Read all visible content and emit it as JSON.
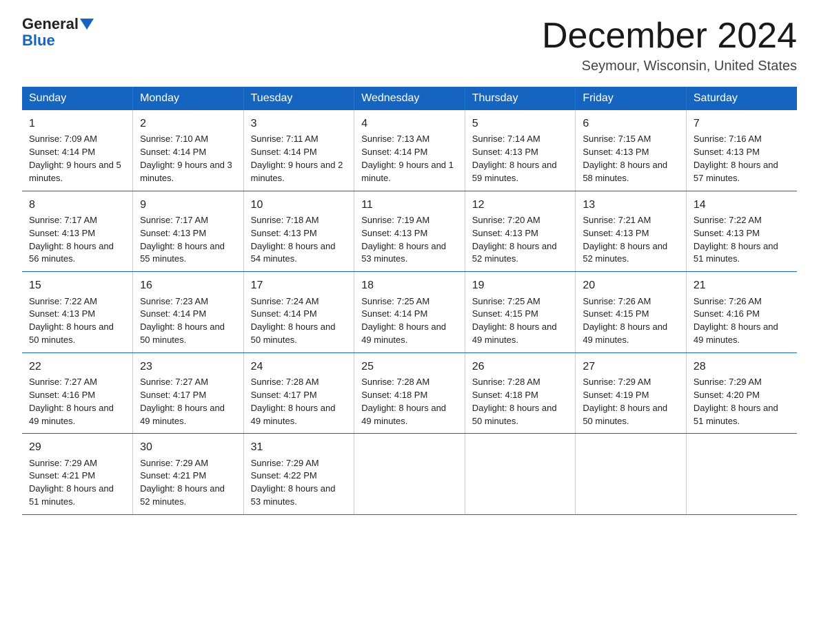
{
  "logo": {
    "general": "General",
    "blue": "Blue"
  },
  "title": {
    "month_year": "December 2024",
    "location": "Seymour, Wisconsin, United States"
  },
  "days_of_week": [
    "Sunday",
    "Monday",
    "Tuesday",
    "Wednesday",
    "Thursday",
    "Friday",
    "Saturday"
  ],
  "weeks": [
    [
      {
        "day": "1",
        "sunrise": "Sunrise: 7:09 AM",
        "sunset": "Sunset: 4:14 PM",
        "daylight": "Daylight: 9 hours and 5 minutes."
      },
      {
        "day": "2",
        "sunrise": "Sunrise: 7:10 AM",
        "sunset": "Sunset: 4:14 PM",
        "daylight": "Daylight: 9 hours and 3 minutes."
      },
      {
        "day": "3",
        "sunrise": "Sunrise: 7:11 AM",
        "sunset": "Sunset: 4:14 PM",
        "daylight": "Daylight: 9 hours and 2 minutes."
      },
      {
        "day": "4",
        "sunrise": "Sunrise: 7:13 AM",
        "sunset": "Sunset: 4:14 PM",
        "daylight": "Daylight: 9 hours and 1 minute."
      },
      {
        "day": "5",
        "sunrise": "Sunrise: 7:14 AM",
        "sunset": "Sunset: 4:13 PM",
        "daylight": "Daylight: 8 hours and 59 minutes."
      },
      {
        "day": "6",
        "sunrise": "Sunrise: 7:15 AM",
        "sunset": "Sunset: 4:13 PM",
        "daylight": "Daylight: 8 hours and 58 minutes."
      },
      {
        "day": "7",
        "sunrise": "Sunrise: 7:16 AM",
        "sunset": "Sunset: 4:13 PM",
        "daylight": "Daylight: 8 hours and 57 minutes."
      }
    ],
    [
      {
        "day": "8",
        "sunrise": "Sunrise: 7:17 AM",
        "sunset": "Sunset: 4:13 PM",
        "daylight": "Daylight: 8 hours and 56 minutes."
      },
      {
        "day": "9",
        "sunrise": "Sunrise: 7:17 AM",
        "sunset": "Sunset: 4:13 PM",
        "daylight": "Daylight: 8 hours and 55 minutes."
      },
      {
        "day": "10",
        "sunrise": "Sunrise: 7:18 AM",
        "sunset": "Sunset: 4:13 PM",
        "daylight": "Daylight: 8 hours and 54 minutes."
      },
      {
        "day": "11",
        "sunrise": "Sunrise: 7:19 AM",
        "sunset": "Sunset: 4:13 PM",
        "daylight": "Daylight: 8 hours and 53 minutes."
      },
      {
        "day": "12",
        "sunrise": "Sunrise: 7:20 AM",
        "sunset": "Sunset: 4:13 PM",
        "daylight": "Daylight: 8 hours and 52 minutes."
      },
      {
        "day": "13",
        "sunrise": "Sunrise: 7:21 AM",
        "sunset": "Sunset: 4:13 PM",
        "daylight": "Daylight: 8 hours and 52 minutes."
      },
      {
        "day": "14",
        "sunrise": "Sunrise: 7:22 AM",
        "sunset": "Sunset: 4:13 PM",
        "daylight": "Daylight: 8 hours and 51 minutes."
      }
    ],
    [
      {
        "day": "15",
        "sunrise": "Sunrise: 7:22 AM",
        "sunset": "Sunset: 4:13 PM",
        "daylight": "Daylight: 8 hours and 50 minutes."
      },
      {
        "day": "16",
        "sunrise": "Sunrise: 7:23 AM",
        "sunset": "Sunset: 4:14 PM",
        "daylight": "Daylight: 8 hours and 50 minutes."
      },
      {
        "day": "17",
        "sunrise": "Sunrise: 7:24 AM",
        "sunset": "Sunset: 4:14 PM",
        "daylight": "Daylight: 8 hours and 50 minutes."
      },
      {
        "day": "18",
        "sunrise": "Sunrise: 7:25 AM",
        "sunset": "Sunset: 4:14 PM",
        "daylight": "Daylight: 8 hours and 49 minutes."
      },
      {
        "day": "19",
        "sunrise": "Sunrise: 7:25 AM",
        "sunset": "Sunset: 4:15 PM",
        "daylight": "Daylight: 8 hours and 49 minutes."
      },
      {
        "day": "20",
        "sunrise": "Sunrise: 7:26 AM",
        "sunset": "Sunset: 4:15 PM",
        "daylight": "Daylight: 8 hours and 49 minutes."
      },
      {
        "day": "21",
        "sunrise": "Sunrise: 7:26 AM",
        "sunset": "Sunset: 4:16 PM",
        "daylight": "Daylight: 8 hours and 49 minutes."
      }
    ],
    [
      {
        "day": "22",
        "sunrise": "Sunrise: 7:27 AM",
        "sunset": "Sunset: 4:16 PM",
        "daylight": "Daylight: 8 hours and 49 minutes."
      },
      {
        "day": "23",
        "sunrise": "Sunrise: 7:27 AM",
        "sunset": "Sunset: 4:17 PM",
        "daylight": "Daylight: 8 hours and 49 minutes."
      },
      {
        "day": "24",
        "sunrise": "Sunrise: 7:28 AM",
        "sunset": "Sunset: 4:17 PM",
        "daylight": "Daylight: 8 hours and 49 minutes."
      },
      {
        "day": "25",
        "sunrise": "Sunrise: 7:28 AM",
        "sunset": "Sunset: 4:18 PM",
        "daylight": "Daylight: 8 hours and 49 minutes."
      },
      {
        "day": "26",
        "sunrise": "Sunrise: 7:28 AM",
        "sunset": "Sunset: 4:18 PM",
        "daylight": "Daylight: 8 hours and 50 minutes."
      },
      {
        "day": "27",
        "sunrise": "Sunrise: 7:29 AM",
        "sunset": "Sunset: 4:19 PM",
        "daylight": "Daylight: 8 hours and 50 minutes."
      },
      {
        "day": "28",
        "sunrise": "Sunrise: 7:29 AM",
        "sunset": "Sunset: 4:20 PM",
        "daylight": "Daylight: 8 hours and 51 minutes."
      }
    ],
    [
      {
        "day": "29",
        "sunrise": "Sunrise: 7:29 AM",
        "sunset": "Sunset: 4:21 PM",
        "daylight": "Daylight: 8 hours and 51 minutes."
      },
      {
        "day": "30",
        "sunrise": "Sunrise: 7:29 AM",
        "sunset": "Sunset: 4:21 PM",
        "daylight": "Daylight: 8 hours and 52 minutes."
      },
      {
        "day": "31",
        "sunrise": "Sunrise: 7:29 AM",
        "sunset": "Sunset: 4:22 PM",
        "daylight": "Daylight: 8 hours and 53 minutes."
      },
      null,
      null,
      null,
      null
    ]
  ]
}
